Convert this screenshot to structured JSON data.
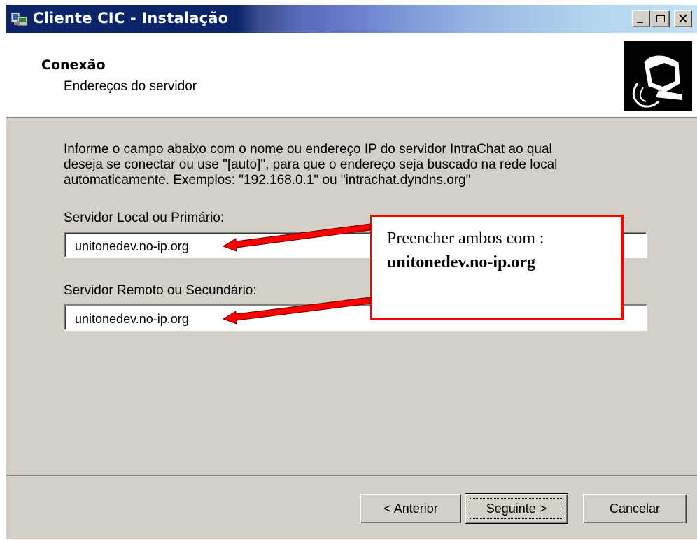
{
  "window": {
    "title": "Cliente CIC - Instalação",
    "controls": [
      "minimize",
      "maximize",
      "close"
    ]
  },
  "header": {
    "title": "Conexão",
    "subtitle": "Endereços do servidor"
  },
  "body": {
    "instructions": [
      "Informe o campo abaixo com o nome ou endereço IP do servidor IntraChat ao qual",
      "deseja se conectar ou use \"[auto]\", para que o endereço seja buscado na rede local",
      "automaticamente. Exemplos: \"192.168.0.1\" ou \"intrachat.dyndns.org\""
    ],
    "local_server": {
      "label": "Servidor Local ou Primário:",
      "value": "unitonedev.no-ip.org"
    },
    "remote_server": {
      "label": "Servidor Remoto ou Secundário:",
      "value": "unitonedev.no-ip.org"
    }
  },
  "annotation": {
    "line1": "Preencher ambos com :",
    "line2": "unitonedev.no-ip.org",
    "border_color": "#ff0000",
    "arrow_color": "#ff0000"
  },
  "buttons": {
    "previous": "< Anterior",
    "next": "Seguinte >",
    "cancel": "Cancelar"
  },
  "colors": {
    "titlebar_start": "#0a246a",
    "titlebar_end": "#c4e0f4",
    "dialog_face": "#d4d0c8"
  }
}
